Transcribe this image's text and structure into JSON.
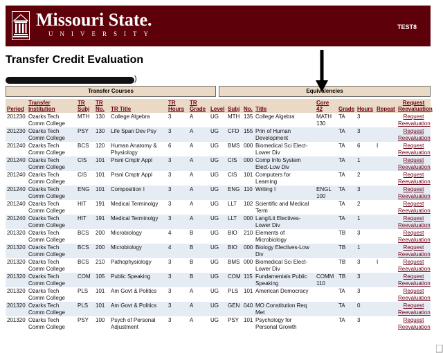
{
  "header": {
    "logo_text": "Missouri State.",
    "logo_subtext": "UNIVERSITY",
    "user_label": "TEST8"
  },
  "page_title": "Transfer Credit Evaluation",
  "student_suffix": ")",
  "group_headers": {
    "transfer": "Transfer Courses",
    "equivalencies": "Equivalencies"
  },
  "columns": {
    "period": "Period",
    "institution": "Transfer Institution",
    "tr_subj": "TR Subj",
    "tr_no": "TR No.",
    "tr_title": "TR Title",
    "tr_hours": "TR Hours",
    "tr_grade": "TR Grade",
    "level": "Level",
    "subj": "Subj",
    "no": "No.",
    "title": "Title",
    "core": "Core 42",
    "grade": "Grade",
    "hours": "Hours",
    "repeat": "Repeat",
    "request": "Request Reevaluation"
  },
  "rows": [
    {
      "period": "201230",
      "institution": "Ozarks Tech Comm College",
      "tr_subj": "MTH",
      "tr_no": "130",
      "tr_title": "College Algebra",
      "tr_hours": "3",
      "tr_grade": "A",
      "level": "UG",
      "subj": "MTH",
      "no": "135",
      "title": "College Algebra",
      "core": "MATH 130",
      "grade": "TA",
      "hours": "3",
      "repeat": "",
      "request": "Request Reevaluation"
    },
    {
      "period": "201230",
      "institution": "Ozarks Tech Comm College",
      "tr_subj": "PSY",
      "tr_no": "130",
      "tr_title": "Life Span Dev Psy",
      "tr_hours": "3",
      "tr_grade": "A",
      "level": "UG",
      "subj": "CFD",
      "no": "155",
      "title": "Prin of Human Development",
      "core": "",
      "grade": "TA",
      "hours": "3",
      "repeat": "",
      "request": "Request Reevaluation"
    },
    {
      "period": "201240",
      "institution": "Ozarks Tech Comm College",
      "tr_subj": "BCS",
      "tr_no": "120",
      "tr_title": "Human Anatomy & Physiology",
      "tr_hours": "6",
      "tr_grade": "A",
      "level": "UG",
      "subj": "BMS",
      "no": "000",
      "title": "Biomedical Sci Elect-Lower Div",
      "core": "",
      "grade": "TA",
      "hours": "6",
      "repeat": "I",
      "request": "Request Reevaluation"
    },
    {
      "period": "201240",
      "institution": "Ozarks Tech Comm College",
      "tr_subj": "CIS",
      "tr_no": "101",
      "tr_title": "Prsnl Cmptr Appl",
      "tr_hours": "3",
      "tr_grade": "A",
      "level": "UG",
      "subj": "CIS",
      "no": "000",
      "title": "Comp Info System Elect-Low Div",
      "core": "",
      "grade": "TA",
      "hours": "1",
      "repeat": "",
      "request": "Request Reevaluation"
    },
    {
      "period": "201240",
      "institution": "Ozarks Tech Comm College",
      "tr_subj": "CIS",
      "tr_no": "101",
      "tr_title": "Prsnl Cmptr Appl",
      "tr_hours": "3",
      "tr_grade": "A",
      "level": "UG",
      "subj": "CIS",
      "no": "101",
      "title": "Computers for Learning",
      "core": "",
      "grade": "TA",
      "hours": "2",
      "repeat": "",
      "request": "Request Reevaluation"
    },
    {
      "period": "201240",
      "institution": "Ozarks Tech Comm College",
      "tr_subj": "ENG",
      "tr_no": "101",
      "tr_title": "Composition I",
      "tr_hours": "3",
      "tr_grade": "A",
      "level": "UG",
      "subj": "ENG",
      "no": "110",
      "title": "Writing I",
      "core": "ENGL 100",
      "grade": "TA",
      "hours": "3",
      "repeat": "",
      "request": "Request Reevaluation"
    },
    {
      "period": "201240",
      "institution": "Ozarks Tech Comm College",
      "tr_subj": "HIT",
      "tr_no": "191",
      "tr_title": "Medical Terminolgy",
      "tr_hours": "3",
      "tr_grade": "A",
      "level": "UG",
      "subj": "LLT",
      "no": "102",
      "title": "Scientific and Medical Term",
      "core": "",
      "grade": "TA",
      "hours": "2",
      "repeat": "",
      "request": "Request Reevaluation"
    },
    {
      "period": "201240",
      "institution": "Ozarks Tech Comm College",
      "tr_subj": "HIT",
      "tr_no": "191",
      "tr_title": "Medical Terminolgy",
      "tr_hours": "3",
      "tr_grade": "A",
      "level": "UG",
      "subj": "LLT",
      "no": "000",
      "title": "Lang/Lit Electives-Lower Div",
      "core": "",
      "grade": "TA",
      "hours": "1",
      "repeat": "",
      "request": "Request Reevaluation"
    },
    {
      "period": "201320",
      "institution": "Ozarks Tech Comm College",
      "tr_subj": "BCS",
      "tr_no": "200",
      "tr_title": "Microbiology",
      "tr_hours": "4",
      "tr_grade": "B",
      "level": "UG",
      "subj": "BIO",
      "no": "210",
      "title": "Elements of Microbiology",
      "core": "",
      "grade": "TB",
      "hours": "3",
      "repeat": "",
      "request": "Request Reevaluation"
    },
    {
      "period": "201320",
      "institution": "Ozarks Tech Comm College",
      "tr_subj": "BCS",
      "tr_no": "200",
      "tr_title": "Microbiology",
      "tr_hours": "4",
      "tr_grade": "B",
      "level": "UG",
      "subj": "BIO",
      "no": "000",
      "title": "Biology Electives-Low Div",
      "core": "",
      "grade": "TB",
      "hours": "1",
      "repeat": "",
      "request": "Request Reevaluation"
    },
    {
      "period": "201320",
      "institution": "Ozarks Tech Comm College",
      "tr_subj": "BCS",
      "tr_no": "210",
      "tr_title": "Pathophysiology",
      "tr_hours": "3",
      "tr_grade": "B",
      "level": "UG",
      "subj": "BMS",
      "no": "000",
      "title": "Biomedical Sci Elect-Lower Div",
      "core": "",
      "grade": "TB",
      "hours": "3",
      "repeat": "I",
      "request": "Request Reevaluation"
    },
    {
      "period": "201320",
      "institution": "Ozarks Tech Comm College",
      "tr_subj": "COM",
      "tr_no": "105",
      "tr_title": "Public Speaking",
      "tr_hours": "3",
      "tr_grade": "B",
      "level": "UG",
      "subj": "COM",
      "no": "115",
      "title": "Fundamentals Public Speaking",
      "core": "COMM 110",
      "grade": "TB",
      "hours": "3",
      "repeat": "",
      "request": "Request Reevaluation"
    },
    {
      "period": "201320",
      "institution": "Ozarks Tech Comm College",
      "tr_subj": "PLS",
      "tr_no": "101",
      "tr_title": "Am Govt & Politics",
      "tr_hours": "3",
      "tr_grade": "A",
      "level": "UG",
      "subj": "PLS",
      "no": "101",
      "title": "American Democracy",
      "core": "",
      "grade": "TA",
      "hours": "3",
      "repeat": "",
      "request": "Request Reevaluation"
    },
    {
      "period": "201320",
      "institution": "Ozarks Tech Comm College",
      "tr_subj": "PLS",
      "tr_no": "101",
      "tr_title": "Am Govt & Politics",
      "tr_hours": "3",
      "tr_grade": "A",
      "level": "UG",
      "subj": "GEN",
      "no": "040",
      "title": "MO Constitution Req Met",
      "core": "",
      "grade": "TA",
      "hours": "0",
      "repeat": "",
      "request": "Request Reevaluation"
    },
    {
      "period": "201320",
      "institution": "Ozarks Tech Comm College",
      "tr_subj": "PSY",
      "tr_no": "100",
      "tr_title": "Psych of Personal Adjustment",
      "tr_hours": "3",
      "tr_grade": "A",
      "level": "UG",
      "subj": "PSY",
      "no": "101",
      "title": "Psychology for Personal Growth",
      "core": "",
      "grade": "TA",
      "hours": "3",
      "repeat": "",
      "request": "Request Reevaluation"
    }
  ],
  "colors": {
    "banner": "#5e0009",
    "header_bg": "#ead9c4",
    "header_text": "#6b0015",
    "alt_row": "#e6ecf4"
  },
  "icons": {
    "seal": "university-seal-icon",
    "arrow": "arrow-down-icon"
  }
}
